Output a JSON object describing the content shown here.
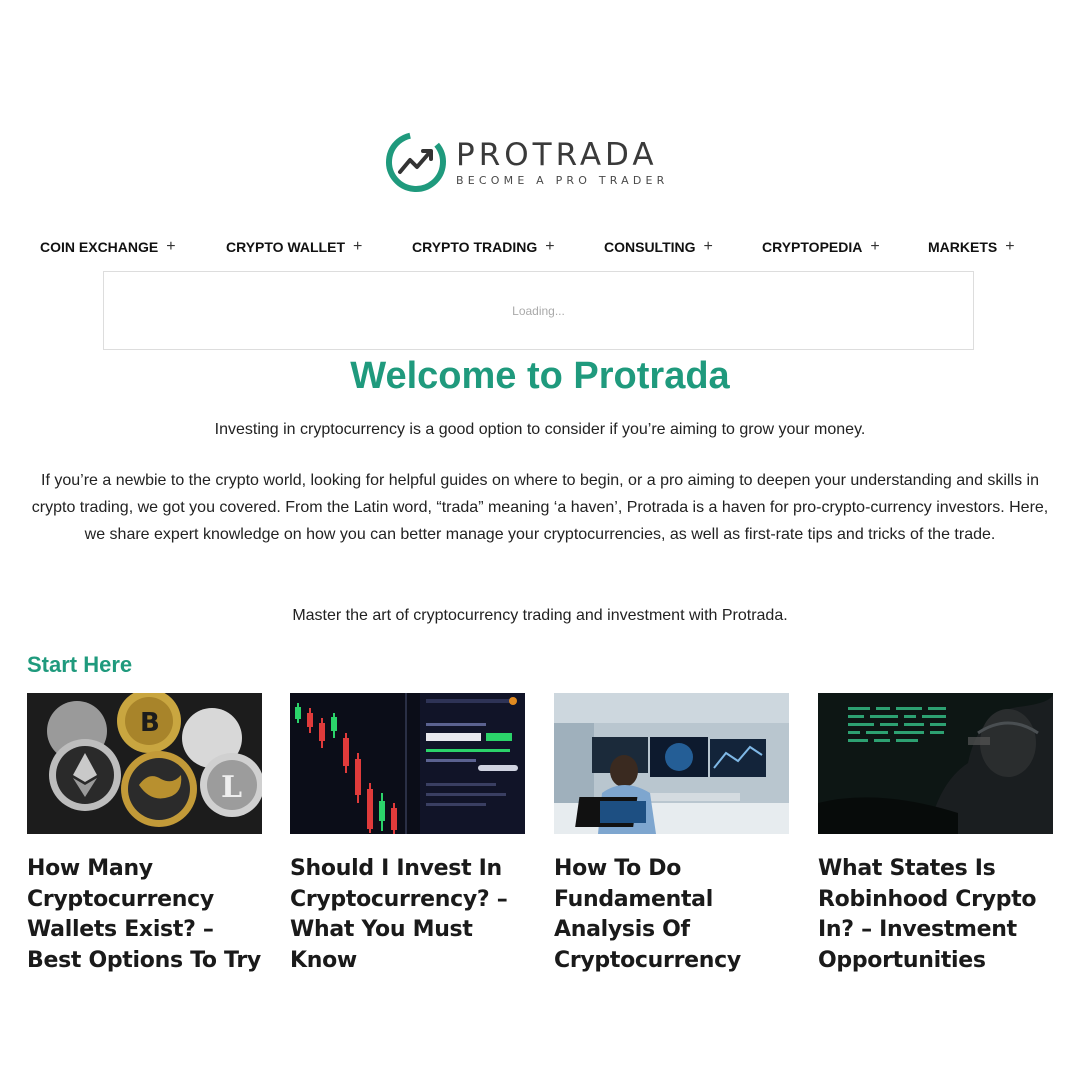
{
  "brand": {
    "name": "PROTRADA",
    "tagline": "BECOME A PRO TRADER",
    "color": "#1f9a7d"
  },
  "nav": {
    "items": [
      {
        "label": "COIN EXCHANGE",
        "icon": "plus-icon"
      },
      {
        "label": "CRYPTO WALLET",
        "icon": "plus-icon"
      },
      {
        "label": "CRYPTO TRADING",
        "icon": "plus-icon"
      },
      {
        "label": "CONSULTING",
        "icon": "plus-icon"
      },
      {
        "label": "CRYPTOPEDIA",
        "icon": "plus-icon"
      },
      {
        "label": "MARKETS",
        "icon": "plus-icon"
      }
    ],
    "expand_symbol": "+"
  },
  "ticker": {
    "status": "Loading..."
  },
  "hero": {
    "title": "Welcome to Protrada",
    "intro": "Investing in cryptocurrency is a good option to consider if you’re aiming to grow your money.",
    "body": "If you’re a newbie to the crypto world, looking for helpful guides on where to begin, or a pro aiming to deepen your understanding and skills in crypto trading, we got you covered. From the Latin word, “trada” meaning ‘a haven’, Protrada is a haven for pro-crypto-currency investors. Here, we share expert knowledge on how you can better manage your cryptocurrencies, as well as first-rate tips and tricks of the trade.",
    "closing": "Master the art of cryptocurrency trading and investment with Protrada."
  },
  "start_here": {
    "title": "Start Here",
    "articles": [
      {
        "title": "How Many Cryptocurrency Wallets Exist? – Best Options To Try",
        "image": "crypto-coins-image"
      },
      {
        "title": "Should I Invest In Cryptocurrency? – What You Must Know",
        "image": "trading-chart-image"
      },
      {
        "title": "How To Do Fundamental Analysis Of Cryptocurrency",
        "image": "analyst-workstation-image"
      },
      {
        "title": "What States Is Robinhood Crypto In? – Investment Opportunities",
        "image": "hacker-screen-image"
      }
    ]
  }
}
